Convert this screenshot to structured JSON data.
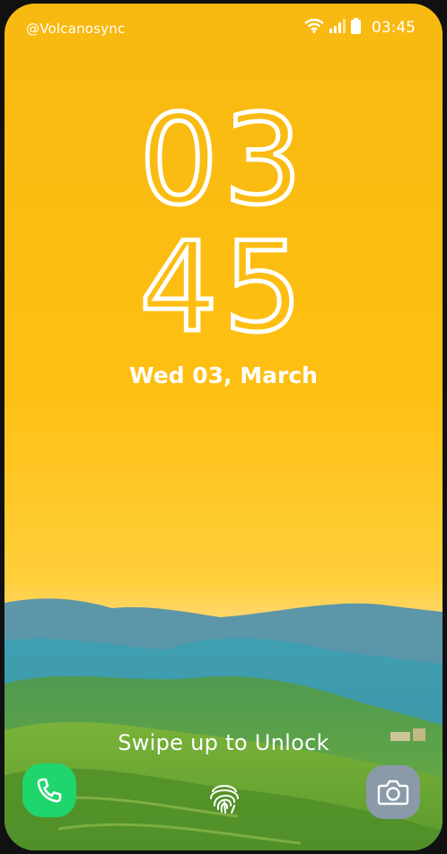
{
  "status_bar": {
    "owner": "@Volcanosync",
    "time": "03:45",
    "icons": [
      "wifi-icon",
      "signal-icon",
      "battery-icon"
    ]
  },
  "lock_screen": {
    "hour": "03",
    "minute": "45",
    "date": "Wed 03, March",
    "unlock_hint": "Swipe up to Unlock"
  },
  "shortcuts": {
    "left": "phone-icon",
    "center": "fingerprint-icon",
    "right": "camera-icon"
  },
  "colors": {
    "sky": "#ffbf12",
    "phone_button": "#1ed66c",
    "camera_button": "#8a9aa8"
  }
}
